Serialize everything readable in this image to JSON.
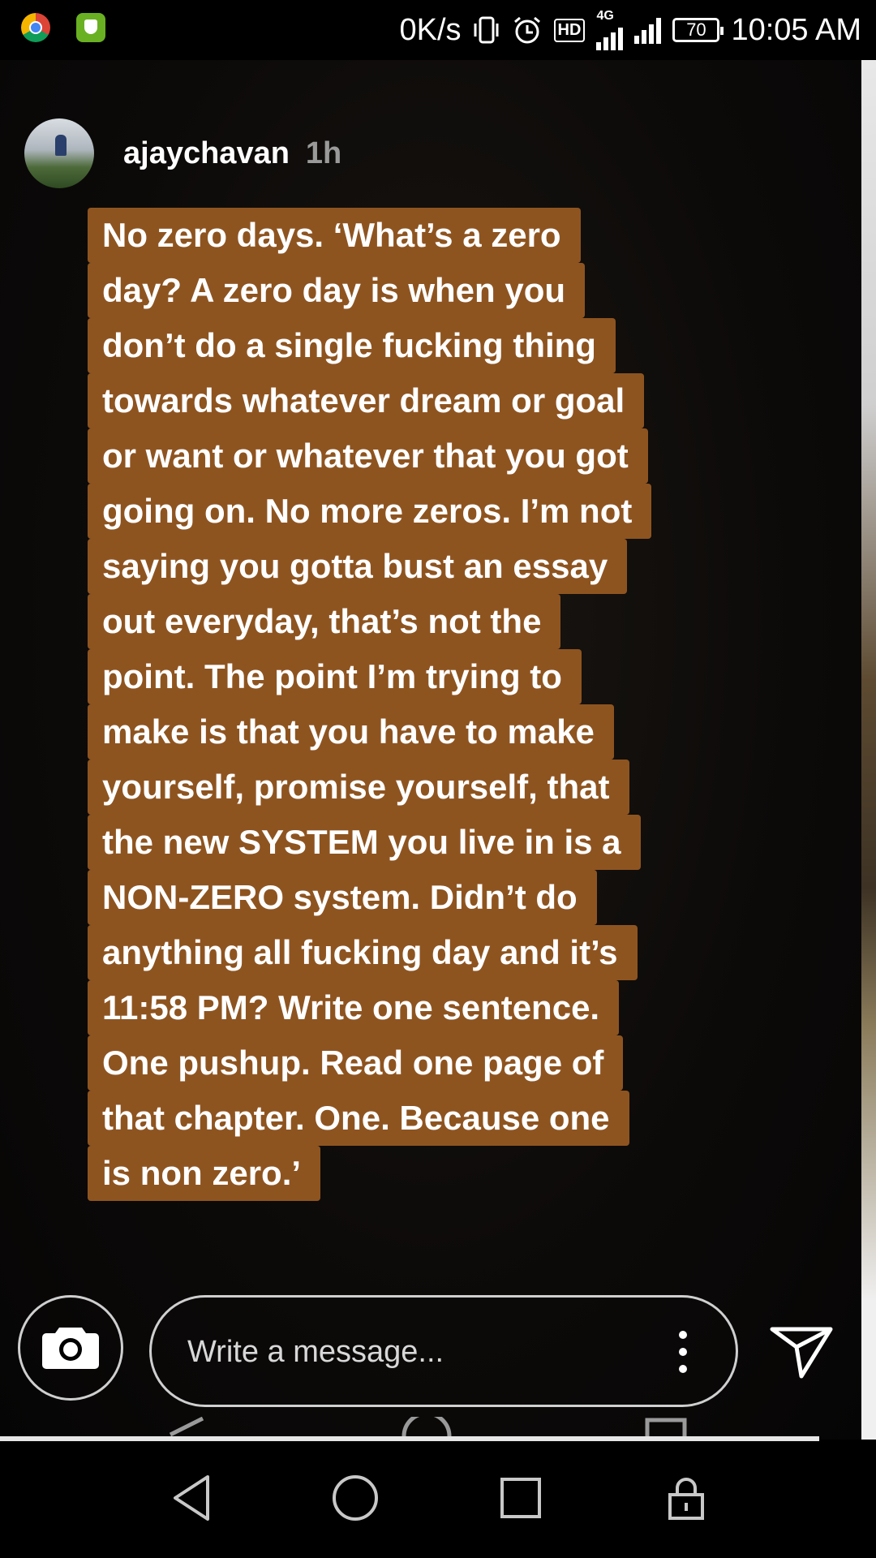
{
  "status_bar": {
    "network_speed": "0K/s",
    "network_type": "4G",
    "hd_label": "HD",
    "battery": "70",
    "time": "10:05 AM",
    "icons": [
      "chrome-icon",
      "shield-app-icon",
      "vibrate-icon",
      "alarm-icon",
      "hd-icon",
      "signal-icon",
      "signal-icon",
      "battery-icon"
    ]
  },
  "story": {
    "username": "ajaychavan",
    "time_ago": "1h",
    "quote_lines": [
      "No zero days. ‘What’s a zero",
      "day? A zero day is when you",
      "don’t do a single fucking thing",
      "towards whatever dream or goal",
      "or want or whatever that you got",
      "going on. No more zeros. I’m not",
      "saying you gotta bust an essay",
      "out everyday, that’s not the",
      "point. The point I’m trying to",
      "make is that you have to make",
      "yourself, promise yourself, that",
      "the new SYSTEM you live in is a",
      "NON-ZERO system. Didn’t do",
      "anything all fucking day and it’s",
      "11:58 PM? Write one sentence.",
      "One pushup. Read one page of",
      "that chapter. One. Because one",
      "is non zero.’"
    ],
    "highlight_color": "#8e5420"
  },
  "reply_bar": {
    "placeholder": "Write a message...",
    "icons": [
      "camera-icon",
      "more-vertical-icon",
      "send-icon"
    ]
  },
  "navigation_bar": {
    "icons": [
      "back-icon",
      "home-icon",
      "recents-icon",
      "lock-icon"
    ]
  }
}
